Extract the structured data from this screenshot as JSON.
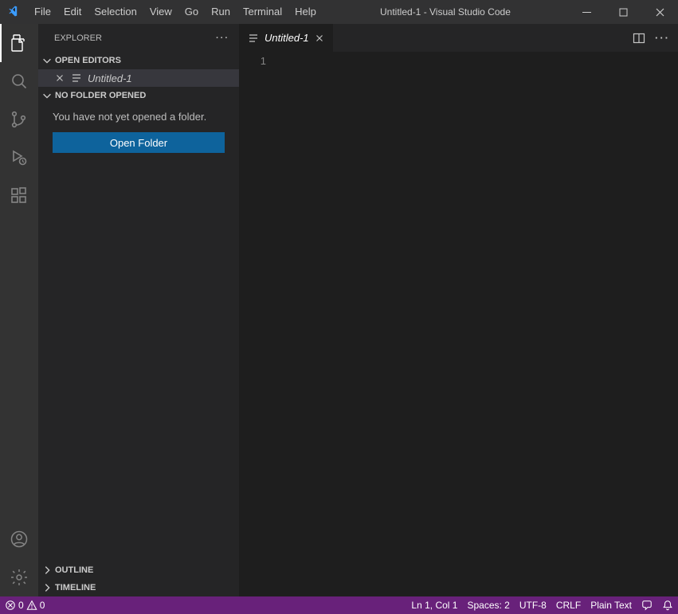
{
  "titlebar": {
    "title": "Untitled-1 - Visual Studio Code",
    "menu": [
      "File",
      "Edit",
      "Selection",
      "View",
      "Go",
      "Run",
      "Terminal",
      "Help"
    ]
  },
  "sidebar": {
    "title": "Explorer",
    "sections": {
      "openEditors": "Open Editors",
      "noFolder": "No Folder Opened",
      "outline": "Outline",
      "timeline": "Timeline"
    },
    "openEditorItem": "Untitled-1",
    "noFolderMessage": "You have not yet opened a folder.",
    "openFolderButton": "Open Folder"
  },
  "editor": {
    "tabLabel": "Untitled-1",
    "lineNumber": "1"
  },
  "statusbar": {
    "errors": "0",
    "warnings": "0",
    "lineCol": "Ln 1, Col 1",
    "spaces": "Spaces: 2",
    "encoding": "UTF-8",
    "eol": "CRLF",
    "language": "Plain Text"
  },
  "colors": {
    "accent": "#0e639c",
    "statusbar": "#68217a"
  }
}
